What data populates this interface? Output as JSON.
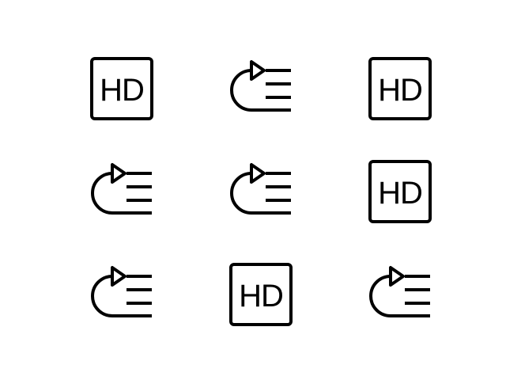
{
  "colors": {
    "background": "#ffffff",
    "stroke": "#000000"
  },
  "icons": [
    {
      "name": "hd-icon",
      "text": "HD"
    },
    {
      "name": "replay-playlist-icon"
    },
    {
      "name": "hd-icon",
      "text": "HD"
    },
    {
      "name": "replay-playlist-icon"
    },
    {
      "name": "replay-playlist-icon"
    },
    {
      "name": "hd-icon",
      "text": "HD"
    },
    {
      "name": "replay-playlist-icon"
    },
    {
      "name": "hd-icon",
      "text": "HD"
    },
    {
      "name": "replay-playlist-icon"
    }
  ]
}
